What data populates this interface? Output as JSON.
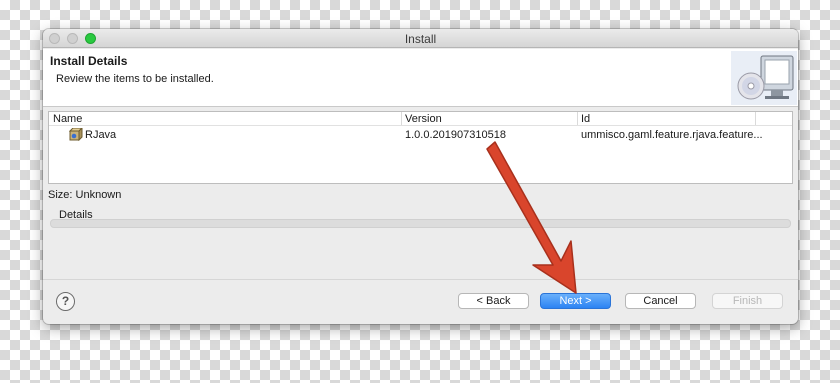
{
  "window": {
    "title": "Install"
  },
  "header": {
    "title": "Install Details",
    "subtitle": "Review the items to be installed."
  },
  "table": {
    "columns": [
      "Name",
      "Version",
      "Id"
    ],
    "rows": [
      {
        "name": "RJava",
        "version": "1.0.0.201907310518",
        "id": "ummisco.gaml.feature.rjava.feature..."
      }
    ]
  },
  "size_label": "Size: Unknown",
  "details_label": "Details",
  "buttons": {
    "help": "?",
    "back": "< Back",
    "next": "Next >",
    "cancel": "Cancel",
    "finish": "Finish"
  },
  "colors": {
    "primary_button": "#2c83f3",
    "arrow": "#d9452c"
  }
}
